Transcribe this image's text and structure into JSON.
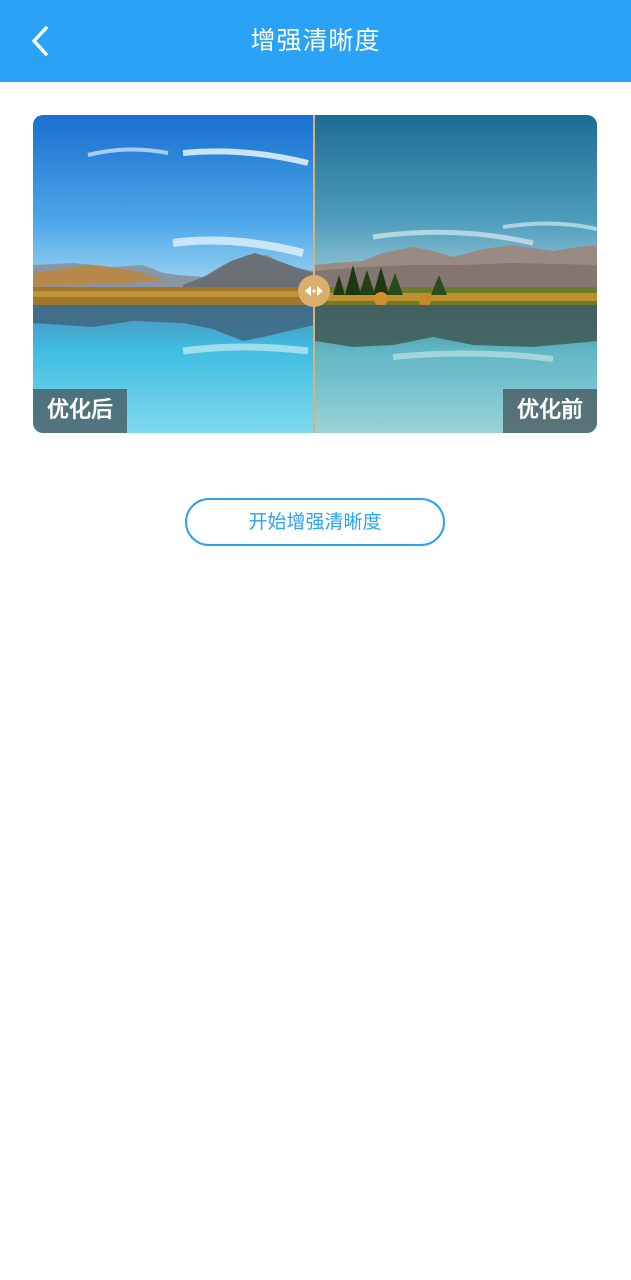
{
  "header": {
    "title": "增强清晰度",
    "background_color": "#2aa2f5",
    "back_icon": "chevron-left-icon"
  },
  "compare": {
    "after_label": "优化后",
    "before_label": "优化前",
    "handle_icon": "left-right-arrows-icon",
    "divider_color": "#d9b172"
  },
  "actions": {
    "start_label": "开始增强清晰度",
    "accent_color": "#2aa2f5"
  }
}
